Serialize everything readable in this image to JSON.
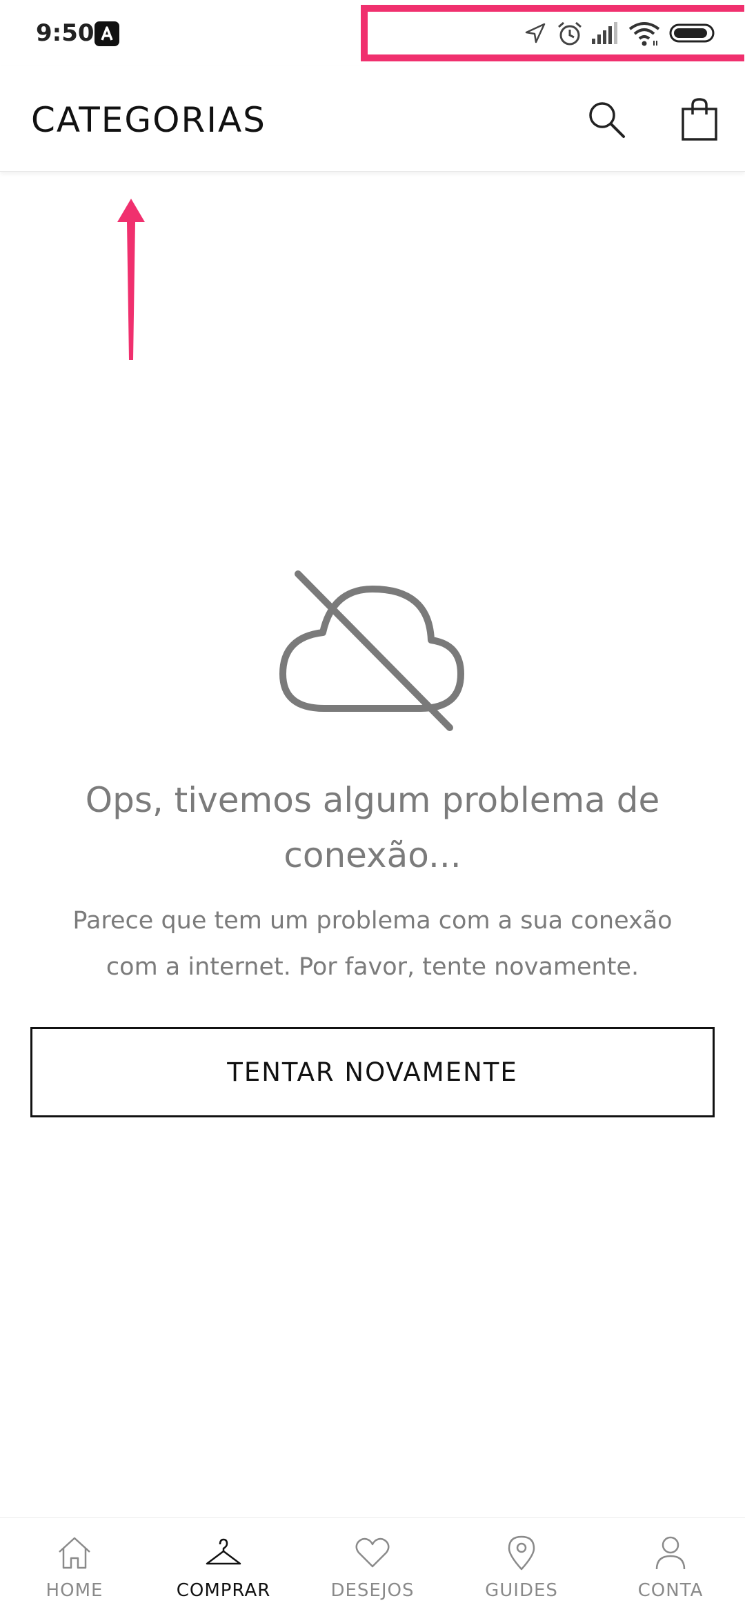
{
  "status_bar": {
    "time": "9:50",
    "icons": [
      "app-notification-icon",
      "location-icon",
      "alarm-icon",
      "signal-icon",
      "wifi-icon",
      "battery-icon"
    ]
  },
  "header": {
    "title": "CATEGORIAS",
    "icons": [
      "search-icon",
      "shopping-bag-icon"
    ]
  },
  "error": {
    "icon": "cloud-off-icon",
    "title_line1": "Ops, tivemos algum problema de",
    "title_line2": "conexão...",
    "message_line1": "Parece que tem um problema com a sua conexão",
    "message_line2": "com a internet. Por favor, tente novamente.",
    "retry_label": "TENTAR NOVAMENTE"
  },
  "bottom_nav": {
    "items": [
      {
        "label": "HOME",
        "icon": "home-icon"
      },
      {
        "label": "COMPRAR",
        "icon": "hanger-icon",
        "active": true
      },
      {
        "label": "DESEJOS",
        "icon": "heart-icon"
      },
      {
        "label": "GUIDES",
        "icon": "map-pin-icon"
      },
      {
        "label": "CONTA",
        "icon": "user-icon"
      }
    ]
  },
  "colors": {
    "annotation": "#f0306e",
    "text_dark": "#111111",
    "text_gray": "#7b7b7b"
  }
}
